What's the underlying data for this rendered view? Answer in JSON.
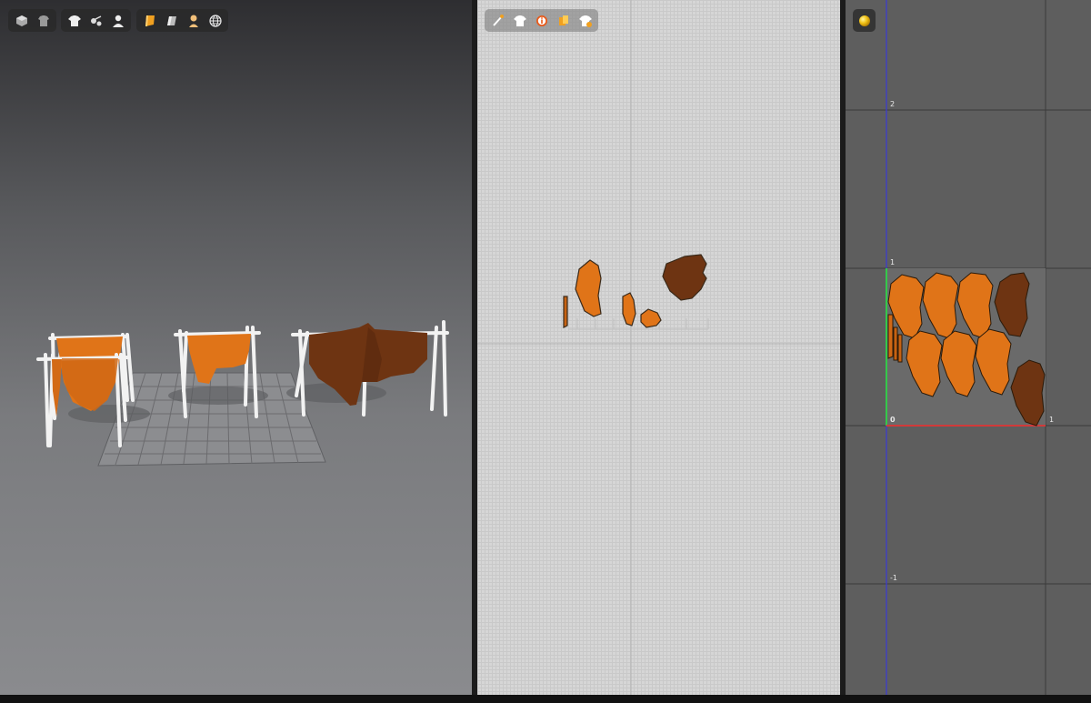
{
  "viewport_3d": {
    "toolbar_groups": [
      {
        "icons": [
          "cube-view-icon",
          "avatar-view-icon"
        ]
      },
      {
        "icons": [
          "garment-icon",
          "fabric-pins-icon",
          "avatar-icon"
        ]
      },
      {
        "icons": [
          "texture-mode-icon",
          "eraser-icon",
          "avatar-skin-icon",
          "mesh-globe-icon"
        ]
      }
    ]
  },
  "viewport_2d": {
    "toolbar_icons": [
      "edit-tool-icon",
      "garment-2d-icon",
      "info-icon",
      "fabric-layers-icon",
      "shirt-sync-icon"
    ]
  },
  "uv_editor": {
    "toolbar_icons": [
      "uv-sphere-icon"
    ],
    "axis_labels": {
      "top": "2",
      "upper": "1",
      "origin": "0",
      "right": "1",
      "lower": "-1"
    }
  },
  "colors": {
    "fabric_orange": "#e07418",
    "fabric_brown": "#6e3412",
    "uv_axis_red": "#d13a3a",
    "uv_axis_green": "#35c84a",
    "uv_axis_blue": "#3a3ad6"
  }
}
